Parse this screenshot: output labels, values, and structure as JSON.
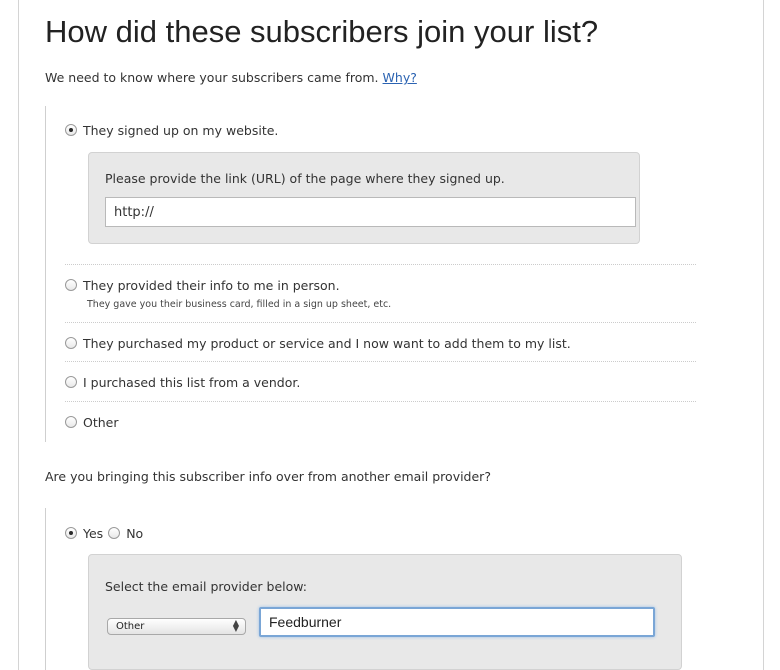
{
  "header": {
    "title": "How did these subscribers join your list?",
    "intro_text": "We need to know where your subscribers came from.",
    "why_link": "Why?"
  },
  "source_options": [
    {
      "label": "They signed up on my website.",
      "selected": true
    },
    {
      "label": "They provided their info to me in person.",
      "selected": false,
      "hint": "They gave you their business card, filled in a sign up sheet, etc."
    },
    {
      "label": "They purchased my product or service and I now want to add them to my list.",
      "selected": false
    },
    {
      "label": "I purchased this list from a vendor.",
      "selected": false
    },
    {
      "label": "Other",
      "selected": false
    }
  ],
  "website_panel": {
    "label": "Please provide the link (URL) of the page where they signed up.",
    "url_value": "http://"
  },
  "provider_question": {
    "text": "Are you bringing this subscriber info over from another email provider?",
    "yes_label": "Yes",
    "no_label": "No",
    "yes_selected": true
  },
  "provider_panel": {
    "label": "Select the email provider below:",
    "selected_provider": "Other",
    "provider_name": "Feedburner"
  },
  "colors": {
    "link": "#2b63b2",
    "panel_bg": "#e8e8e8",
    "focus_border": "#7aa6d6"
  }
}
